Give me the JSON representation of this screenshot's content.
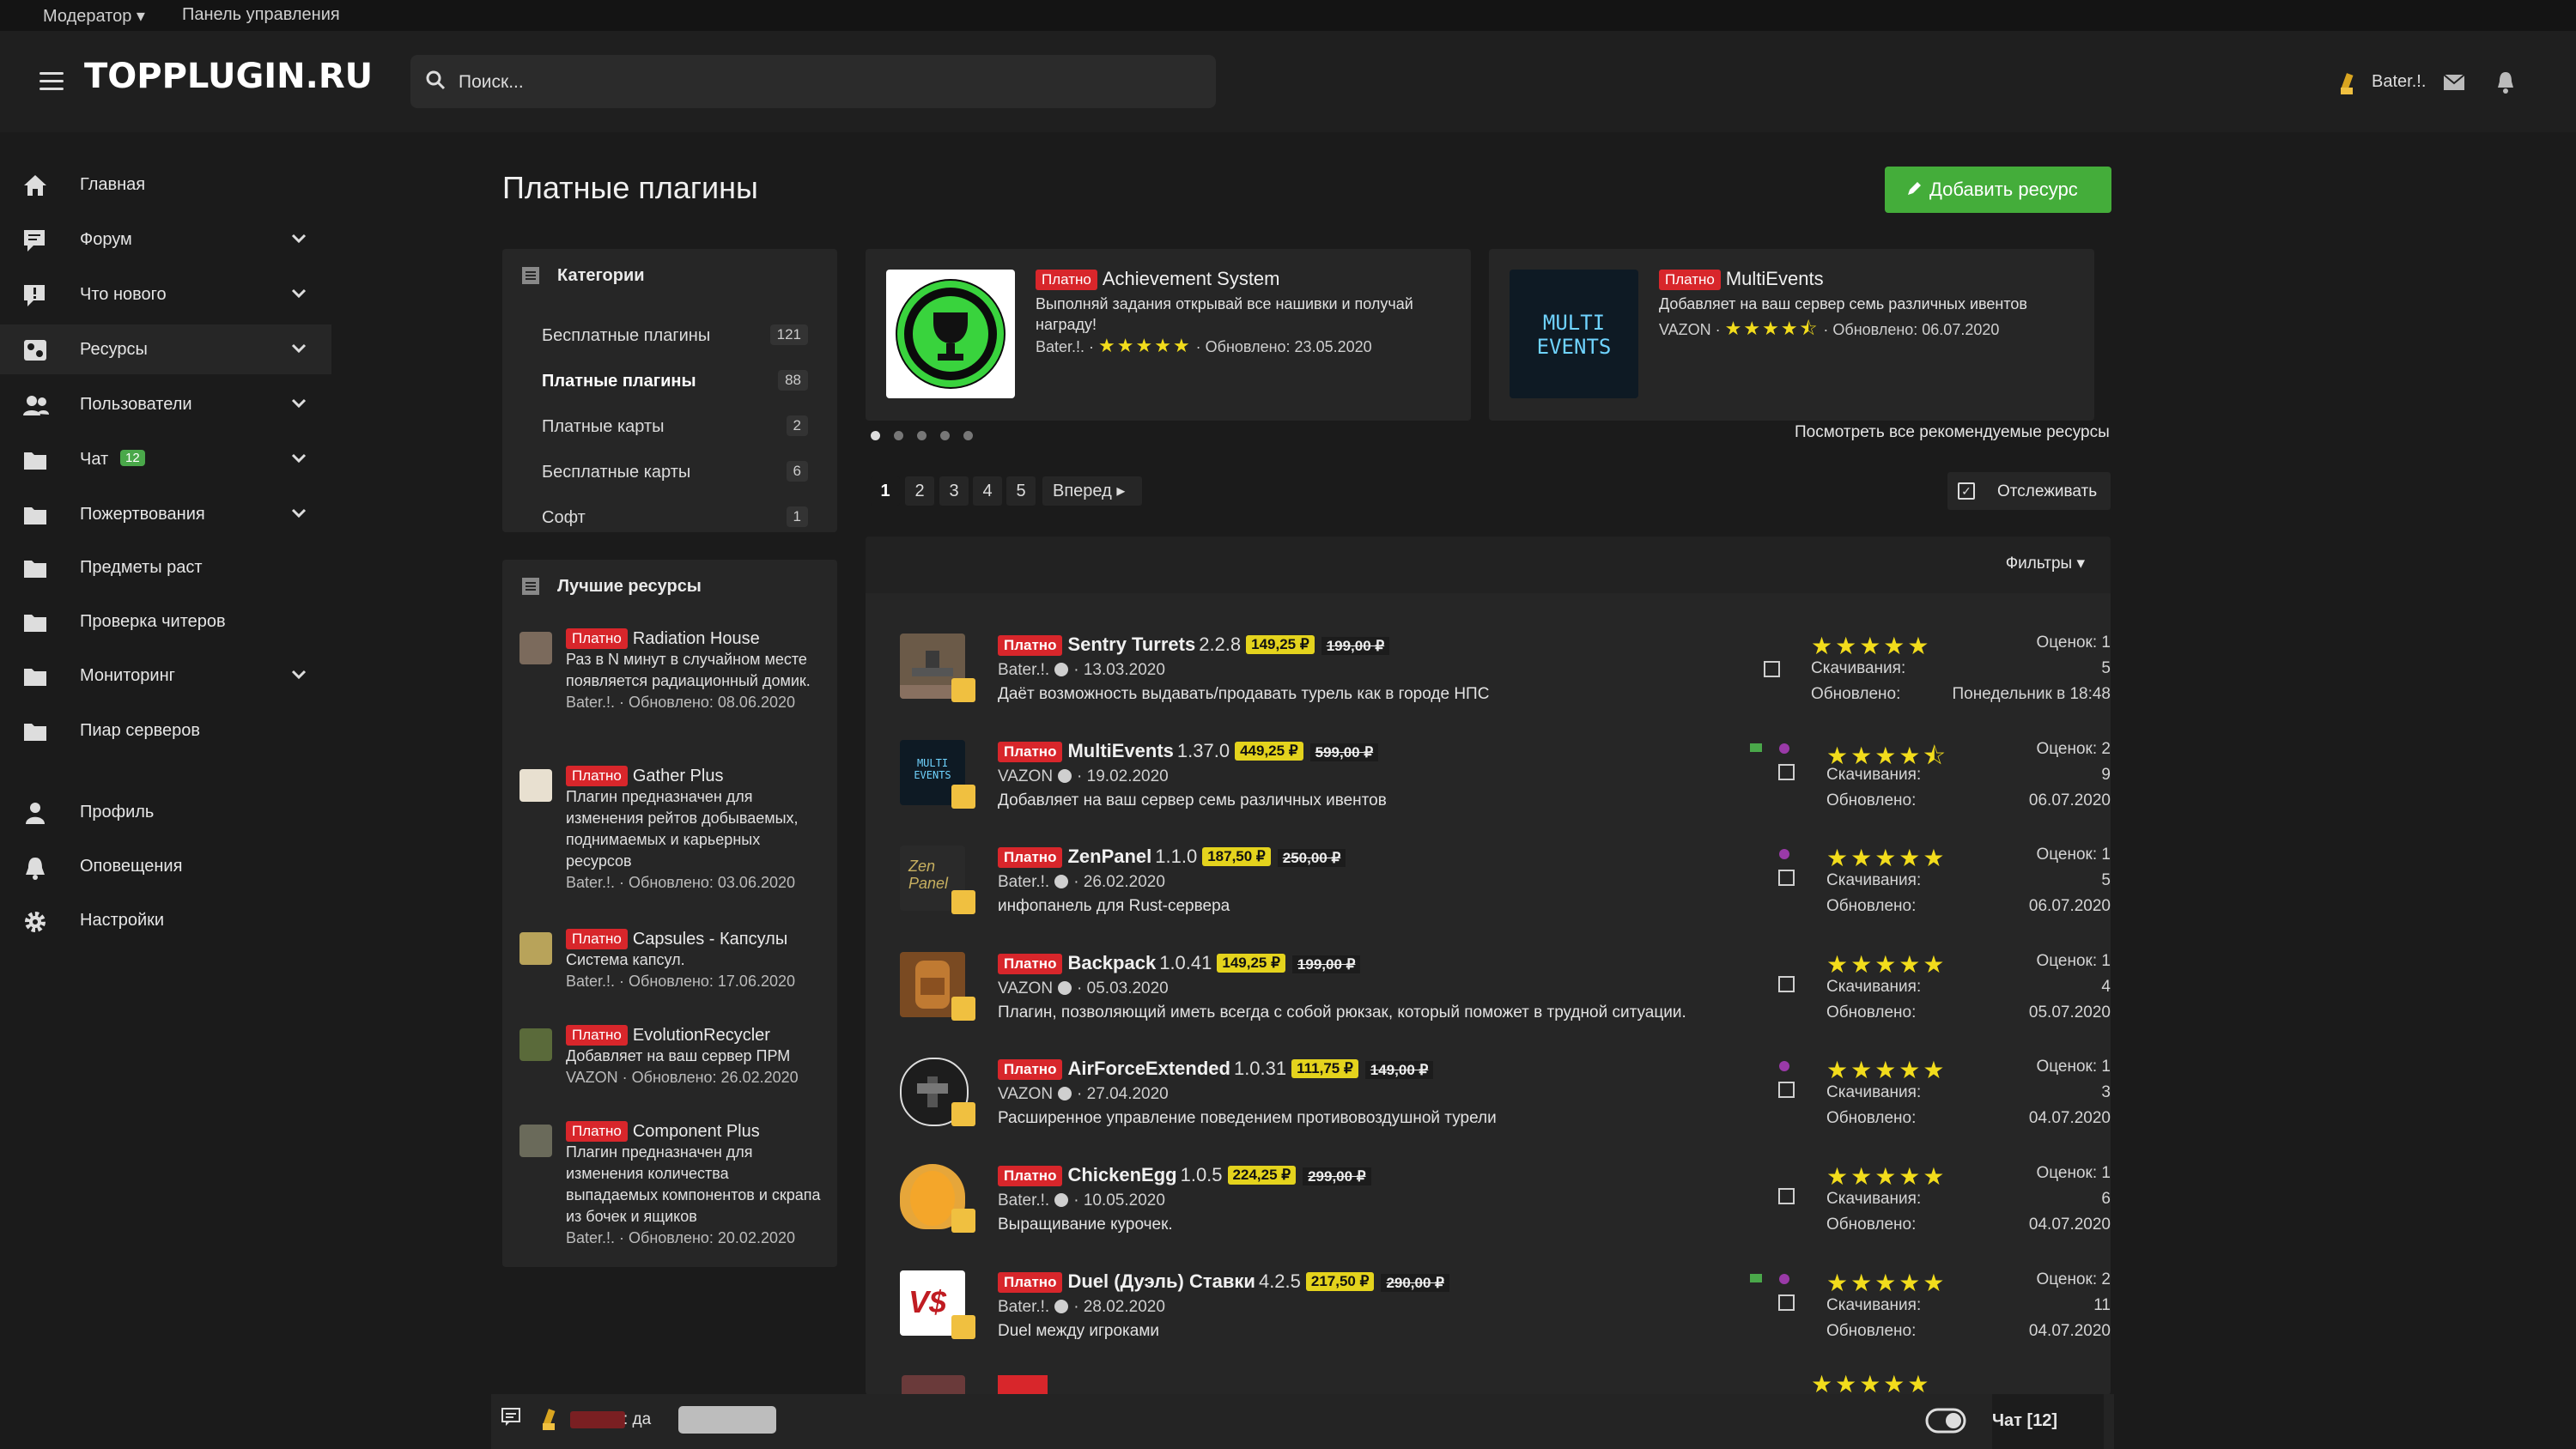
{
  "topstrip": {
    "moderator": "Модератор",
    "dashboard": "Панель управления"
  },
  "header": {
    "logo": "TOPPLUGIN.RU",
    "search_placeholder": "Поиск...",
    "username": "Bater.!."
  },
  "sidebar": {
    "items": [
      {
        "label": "Главная",
        "icon": "home-icon",
        "chevron": false
      },
      {
        "label": "Форум",
        "icon": "forum-icon",
        "chevron": true
      },
      {
        "label": "Что нового",
        "icon": "whats-new-icon",
        "chevron": true
      },
      {
        "label": "Ресурсы",
        "icon": "resources-icon",
        "chevron": true,
        "active": true
      },
      {
        "label": "Пользователи",
        "icon": "users-icon",
        "chevron": true
      },
      {
        "label": "Чат",
        "icon": "folder-icon",
        "chevron": true,
        "badge": "12"
      },
      {
        "label": "Пожертвования",
        "icon": "folder-icon",
        "chevron": true
      },
      {
        "label": "Предметы раст",
        "icon": "folder-icon",
        "chevron": false
      },
      {
        "label": "Проверка читеров",
        "icon": "folder-icon",
        "chevron": false
      },
      {
        "label": "Мониторинг",
        "icon": "folder-icon",
        "chevron": true
      },
      {
        "label": "Пиар серверов",
        "icon": "folder-icon",
        "chevron": false
      },
      {
        "label": "Профиль",
        "icon": "user-icon",
        "chevron": false
      },
      {
        "label": "Оповещения",
        "icon": "bell-icon",
        "chevron": false
      },
      {
        "label": "Настройки",
        "icon": "gear-icon",
        "chevron": false
      }
    ]
  },
  "main": {
    "title": "Платные плагины",
    "add_button": "Добавить ресурс",
    "paid_tag": "Платно",
    "view_all": "Посмотреть все рекомендуемые ресурсы",
    "pagination": [
      "1",
      "2",
      "3",
      "4",
      "5"
    ],
    "next": "Вперед",
    "watch": "Отслеживать",
    "filters": "Фильтры"
  },
  "categories": {
    "title": "Категории",
    "items": [
      {
        "label": "Бесплатные плагины",
        "count": "121"
      },
      {
        "label": "Платные плагины",
        "count": "88",
        "active": true
      },
      {
        "label": "Платные карты",
        "count": "2"
      },
      {
        "label": "Бесплатные карты",
        "count": "6"
      },
      {
        "label": "Софт",
        "count": "1"
      }
    ]
  },
  "best": {
    "title": "Лучшие ресурсы",
    "items": [
      {
        "title": "Radiation House",
        "desc": "Раз в N минут в случайном месте появляется радиационный домик.",
        "meta": "Bater.!. · Обновлено: 08.06.2020"
      },
      {
        "title": "Gather Plus",
        "desc": "Плагин предназначен для изменения рейтов добываемых, поднимаемых и карьерных ресурсов",
        "meta": "Bater.!. · Обновлено: 03.06.2020"
      },
      {
        "title": "Capsules - Капсулы",
        "desc": "Система капсул.",
        "meta": "Bater.!. · Обновлено: 17.06.2020"
      },
      {
        "title": "EvolutionRecycler",
        "desc": "Добавляет на ваш сервер ПРМ",
        "meta": "VAZON · Обновлено: 26.02.2020"
      },
      {
        "title": "Component Plus",
        "desc": "Плагин предназначен для изменения количества выпадаемых компонентов и скрапа из бочек и ящиков",
        "meta": "Bater.!. · Обновлено: 20.02.2020"
      }
    ]
  },
  "featured": [
    {
      "title": "Achievement System",
      "desc": "Выполняй задания открывай все нашивки и получай награду!",
      "author": "Bater.!.",
      "updated": "Обновлено: 23.05.2020",
      "rating": 5
    },
    {
      "title": "MultiEvents",
      "desc": "Добавляет на ваш сервер семь различных ивентов",
      "author": "VAZON",
      "updated": "Обновлено: 06.07.2020",
      "rating": 4.5,
      "logo_text": "MULTI EVENTS"
    }
  ],
  "resources": [
    {
      "name": "Sentry Turrets",
      "version": "2.2.8",
      "price": "149,25 ₽",
      "old_price": "199,00 ₽",
      "author": "Bater.!.",
      "date": "13.03.2020",
      "desc": "Даёт возможность выдавать/продавать турель как в городе НПС",
      "rating": 5,
      "ratings": "Оценок: 1",
      "downloads": "5",
      "updated": "Понедельник в 18:48"
    },
    {
      "name": "MultiEvents",
      "version": "1.37.0",
      "price": "449,25 ₽",
      "old_price": "599,00 ₽",
      "author": "VAZON",
      "date": "19.02.2020",
      "desc": "Добавляет на ваш сервер семь различных ивентов",
      "rating": 4.5,
      "ratings": "Оценок: 2",
      "downloads": "9",
      "updated": "06.07.2020"
    },
    {
      "name": "ZenPanel",
      "version": "1.1.0",
      "price": "187,50 ₽",
      "old_price": "250,00 ₽",
      "author": "Bater.!.",
      "date": "26.02.2020",
      "desc": "инфопанель для Rust-сервера",
      "rating": 5,
      "ratings": "Оценок: 1",
      "downloads": "5",
      "updated": "06.07.2020"
    },
    {
      "name": "Backpack",
      "version": "1.0.41",
      "price": "149,25 ₽",
      "old_price": "199,00 ₽",
      "author": "VAZON",
      "date": "05.03.2020",
      "desc": "Плагин, позволяющий иметь всегда с собой рюкзак, который поможет в трудной ситуации.",
      "rating": 5,
      "ratings": "Оценок: 1",
      "downloads": "4",
      "updated": "05.07.2020"
    },
    {
      "name": "AirForceExtended",
      "version": "1.0.31",
      "price": "111,75 ₽",
      "old_price": "149,00 ₽",
      "author": "VAZON",
      "date": "27.04.2020",
      "desc": "Расширенное управление поведением противовоздушной турели",
      "rating": 5,
      "ratings": "Оценок: 1",
      "downloads": "3",
      "updated": "04.07.2020"
    },
    {
      "name": "ChickenEgg",
      "version": "1.0.5",
      "price": "224,25 ₽",
      "old_price": "299,00 ₽",
      "author": "Bater.!.",
      "date": "10.05.2020",
      "desc": "Выращивание курочек.",
      "rating": 5,
      "ratings": "Оценок: 1",
      "downloads": "6",
      "updated": "04.07.2020"
    },
    {
      "name": "Duel (Дуэль) Ставки",
      "version": "4.2.5",
      "price": "217,50 ₽",
      "old_price": "290,00 ₽",
      "author": "Bater.!.",
      "date": "28.02.2020",
      "desc": "Duel между игроками",
      "rating": 5,
      "ratings": "Оценок: 2",
      "downloads": "11",
      "updated": "04.07.2020"
    }
  ],
  "labels": {
    "downloads": "Скачивания:",
    "updated": "Обновлено:"
  },
  "chat": {
    "message_suffix": ": да",
    "label": "Чат [12]"
  },
  "colors": {
    "accent_green": "#44ad3a",
    "paid_red": "#d8262b",
    "price_yellow": "#e4d31d",
    "star_yellow": "#f2dc1c"
  }
}
